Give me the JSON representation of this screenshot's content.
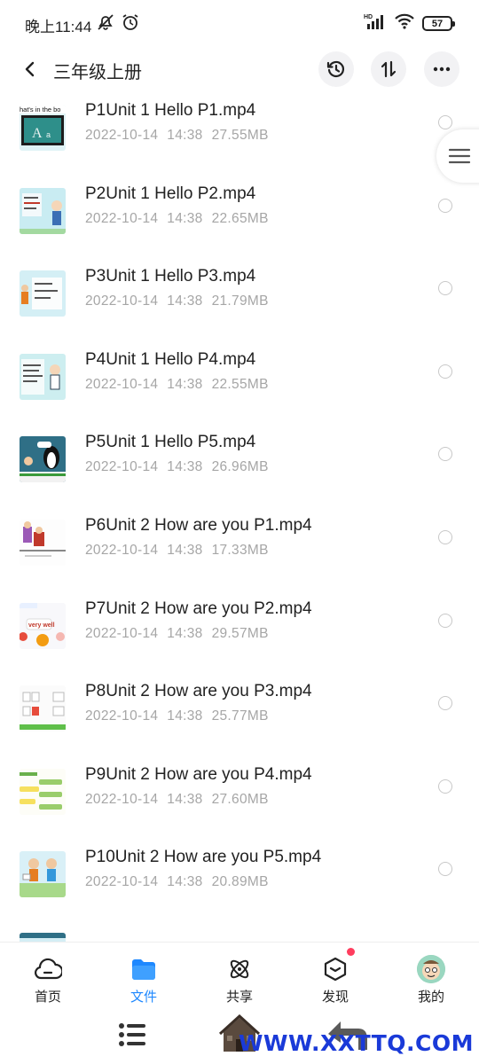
{
  "status_bar": {
    "time": "晚上11:44",
    "battery": "57",
    "network_badge": "HD"
  },
  "header": {
    "title": "三年级上册",
    "icons": [
      "back-arrow-icon",
      "history-icon",
      "sort-icon",
      "more-icon"
    ]
  },
  "files": [
    {
      "name": "P1Unit 1 Hello P1.mp4",
      "date": "2022-10-14",
      "time": "14:38",
      "size": "27.55MB",
      "thumb_text": "hat's in the bo"
    },
    {
      "name": "P2Unit 1 Hello P2.mp4",
      "date": "2022-10-14",
      "time": "14:38",
      "size": "22.65MB"
    },
    {
      "name": "P3Unit 1 Hello P3.mp4",
      "date": "2022-10-14",
      "time": "14:38",
      "size": "21.79MB"
    },
    {
      "name": "P4Unit 1 Hello P4.mp4",
      "date": "2022-10-14",
      "time": "14:38",
      "size": "22.55MB"
    },
    {
      "name": "P5Unit 1 Hello P5.mp4",
      "date": "2022-10-14",
      "time": "14:38",
      "size": "26.96MB"
    },
    {
      "name": "P6Unit 2 How are you P1.mp4",
      "date": "2022-10-14",
      "time": "14:38",
      "size": "17.33MB"
    },
    {
      "name": "P7Unit 2 How are you P2.mp4",
      "date": "2022-10-14",
      "time": "14:38",
      "size": "29.57MB",
      "thumb_text": "very well"
    },
    {
      "name": "P8Unit 2 How are you P3.mp4",
      "date": "2022-10-14",
      "time": "14:38",
      "size": "25.77MB"
    },
    {
      "name": "P9Unit 2 How are you P4.mp4",
      "date": "2022-10-14",
      "time": "14:38",
      "size": "27.60MB"
    },
    {
      "name": "P10Unit 2 How are you P5.mp4",
      "date": "2022-10-14",
      "time": "14:38",
      "size": "20.89MB"
    }
  ],
  "bottom_nav": [
    {
      "label": "首页",
      "icon": "cloud-home-icon",
      "active": false
    },
    {
      "label": "文件",
      "icon": "folder-icon",
      "active": true
    },
    {
      "label": "共享",
      "icon": "share-atom-icon",
      "active": false
    },
    {
      "label": "发现",
      "icon": "discover-box-icon",
      "active": false,
      "badge": true
    },
    {
      "label": "我的",
      "icon": "avatar-icon",
      "active": false
    }
  ],
  "watermark": "WWW.XXTTQ.COM",
  "colors": {
    "accent": "#1e88ff",
    "meta_text": "#a6a6a6",
    "badge": "#ff3d5e",
    "watermark": "#1a3ad8"
  }
}
